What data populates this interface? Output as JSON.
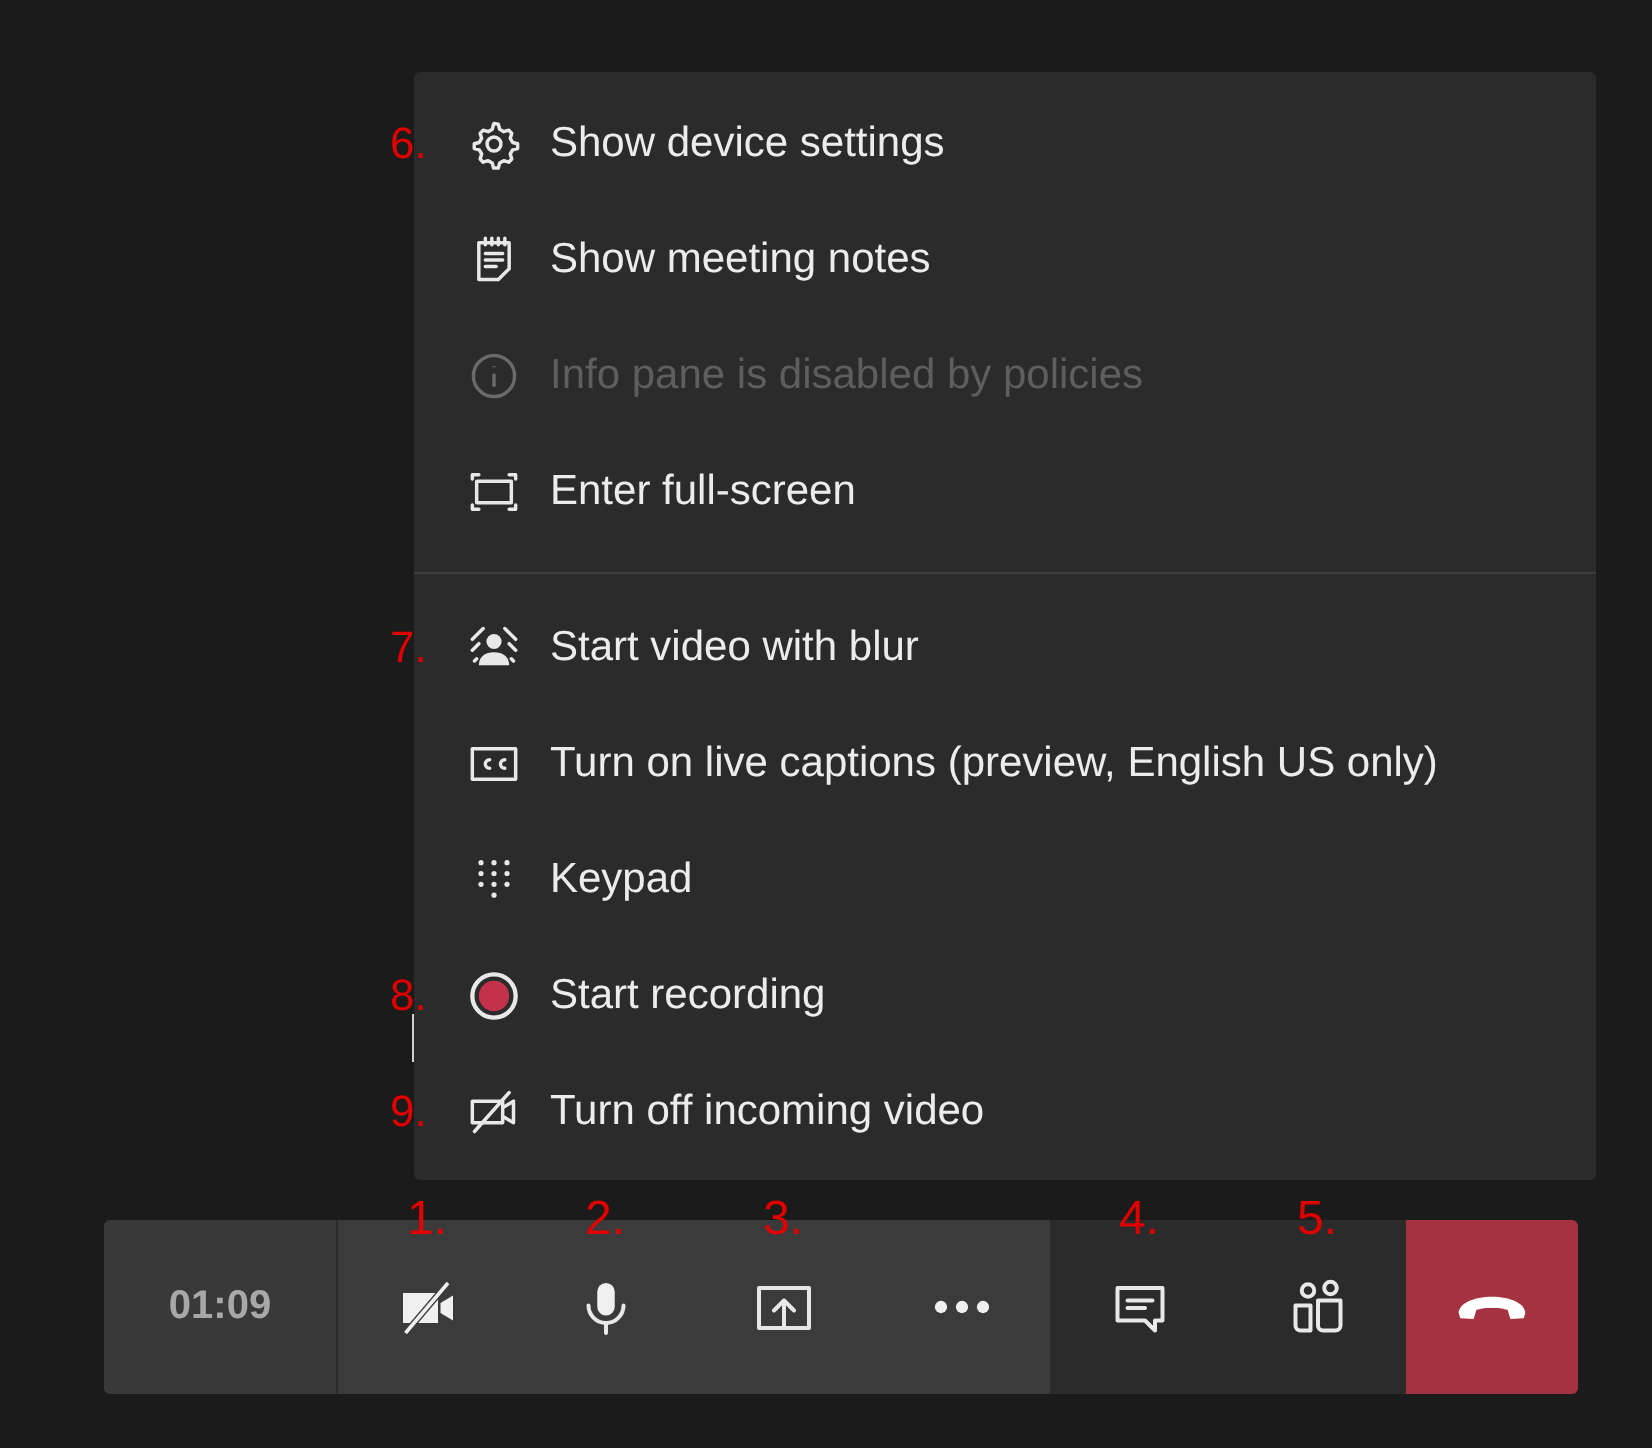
{
  "menu": {
    "sections": [
      {
        "items": [
          {
            "kind": "gear",
            "label": "Show device settings",
            "annotation": "6.",
            "disabled": false
          },
          {
            "kind": "notes",
            "label": "Show meeting notes",
            "disabled": false
          },
          {
            "kind": "info",
            "label": "Info pane is disabled by policies",
            "disabled": true
          },
          {
            "kind": "fullscreen",
            "label": "Enter full-screen",
            "disabled": false
          }
        ]
      },
      {
        "items": [
          {
            "kind": "blur",
            "label": "Start video with blur",
            "annotation": "7.",
            "disabled": false
          },
          {
            "kind": "captions",
            "label": "Turn on live captions (preview, English US only)",
            "disabled": false
          },
          {
            "kind": "keypad",
            "label": "Keypad",
            "disabled": false
          },
          {
            "kind": "record",
            "label": "Start recording",
            "annotation": "8.",
            "disabled": false
          },
          {
            "kind": "video-off",
            "label": "Turn off incoming video",
            "annotation": "9.",
            "disabled": false
          }
        ]
      }
    ]
  },
  "toolbar": {
    "timer": "01:09",
    "groups": [
      [
        {
          "kind": "camera-off",
          "annotation": "1."
        },
        {
          "kind": "mic",
          "annotation": "2."
        },
        {
          "kind": "share",
          "annotation": "3."
        },
        {
          "kind": "more"
        }
      ],
      [
        {
          "kind": "chat",
          "annotation": "4."
        },
        {
          "kind": "people",
          "annotation": "5."
        }
      ]
    ],
    "hangup": {
      "kind": "phone"
    }
  }
}
